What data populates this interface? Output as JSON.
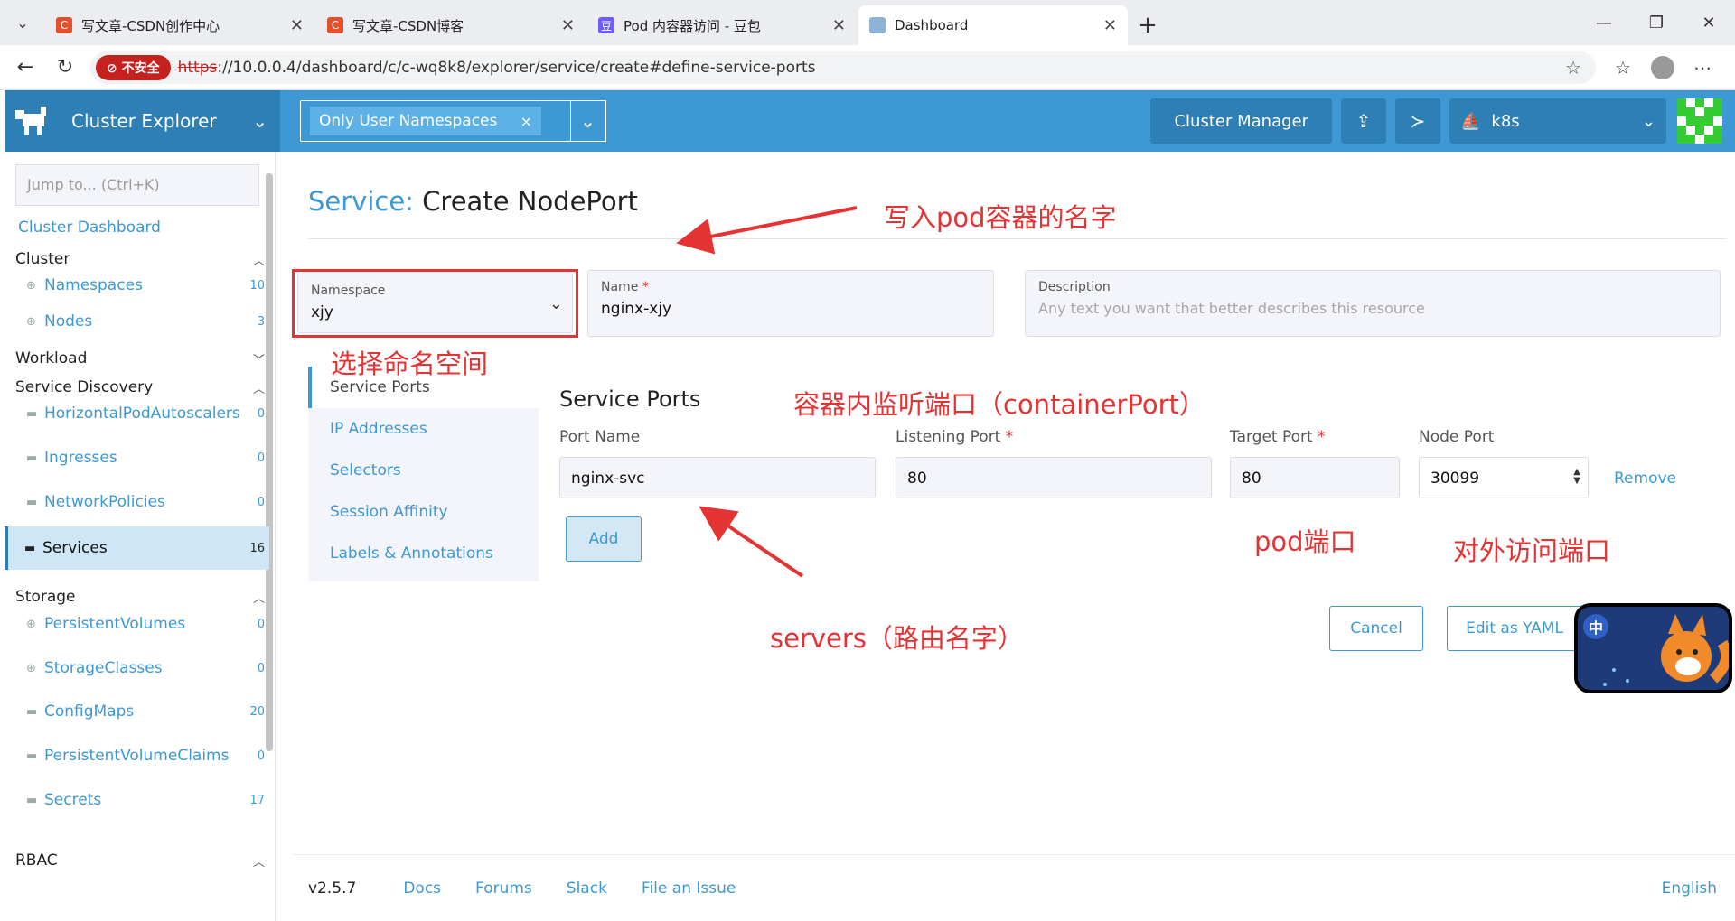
{
  "browser": {
    "tabs": [
      {
        "title": "写文章-CSDN创作中心",
        "favicon": "C",
        "favicon_color": "#e4502b"
      },
      {
        "title": "写文章-CSDN博客",
        "favicon": "C",
        "favicon_color": "#e4502b"
      },
      {
        "title": "Pod 内容器访问 - 豆包",
        "favicon": "豆",
        "favicon_color": "#6d5dfc"
      },
      {
        "title": "Dashboard",
        "favicon": "",
        "favicon_color": "#8fb3d6"
      }
    ],
    "insecure_label": "不安全",
    "url_scheme": "https",
    "url_rest": "://10.0.0.4/dashboard/c/c-wq8k8/explorer/service/create#define-service-ports"
  },
  "header": {
    "brand_title": "Cluster Explorer",
    "namespace_filter": "Only User Namespaces",
    "cluster_manager": "Cluster Manager",
    "cluster_name": "k8s",
    "accent": "#3d98d3",
    "accent_dark": "#2e7fb5"
  },
  "sidebar": {
    "jump_placeholder": "Jump to... (Ctrl+K)",
    "dashboard": "Cluster Dashboard",
    "groups": {
      "cluster": "Cluster",
      "workload": "Workload",
      "service_discovery": "Service Discovery",
      "storage": "Storage",
      "rbac": "RBAC"
    },
    "items": [
      {
        "label": "Namespaces",
        "count": "10",
        "icon": "globe-icon"
      },
      {
        "label": "Nodes",
        "count": "3",
        "icon": "globe-icon"
      },
      {
        "label": "HorizontalPodAutoscalers",
        "count": "0",
        "icon": "folder-icon"
      },
      {
        "label": "Ingresses",
        "count": "0",
        "icon": "folder-icon"
      },
      {
        "label": "NetworkPolicies",
        "count": "0",
        "icon": "folder-icon"
      },
      {
        "label": "Services",
        "count": "16",
        "icon": "folder-icon"
      },
      {
        "label": "PersistentVolumes",
        "count": "0",
        "icon": "globe-icon"
      },
      {
        "label": "StorageClasses",
        "count": "0",
        "icon": "globe-icon"
      },
      {
        "label": "ConfigMaps",
        "count": "20",
        "icon": "folder-icon"
      },
      {
        "label": "PersistentVolumeClaims",
        "count": "0",
        "icon": "folder-icon"
      },
      {
        "label": "Secrets",
        "count": "17",
        "icon": "folder-icon"
      }
    ]
  },
  "page": {
    "title_prefix": "Service:",
    "title_main": "Create NodePort",
    "namespace_label": "Namespace",
    "namespace_value": "xjy",
    "name_label": "Name",
    "name_value": "nginx-xjy",
    "description_label": "Description",
    "description_placeholder": "Any text you want that better describes this resource",
    "side_tabs": [
      "Service Ports",
      "IP Addresses",
      "Selectors",
      "Session Affinity",
      "Labels & Annotations"
    ],
    "ports_heading": "Service Ports",
    "cols": {
      "port_name": "Port Name",
      "listening_port": "Listening Port",
      "target_port": "Target Port",
      "node_port": "Node Port"
    },
    "row": {
      "port_name": "nginx-svc",
      "listening_port": "80",
      "target_port": "80",
      "node_port": "30099"
    },
    "remove": "Remove",
    "add": "Add",
    "cancel": "Cancel",
    "edit_yaml": "Edit as YAML"
  },
  "footer": {
    "version": "v2.5.7",
    "links": [
      "Docs",
      "Forums",
      "Slack",
      "File an Issue"
    ],
    "language": "English"
  },
  "annotations": {
    "name_hint": "写入pod容器的名字",
    "namespace_hint": "选择命名空间",
    "container_port_hint": "容器内监听端口（containerPort）",
    "pod_port_hint": "pod端口",
    "node_port_hint": "对外访问端口",
    "port_name_hint": "servers（路由名字）",
    "color": "#e53333"
  },
  "mascot": {
    "badge": "中"
  }
}
